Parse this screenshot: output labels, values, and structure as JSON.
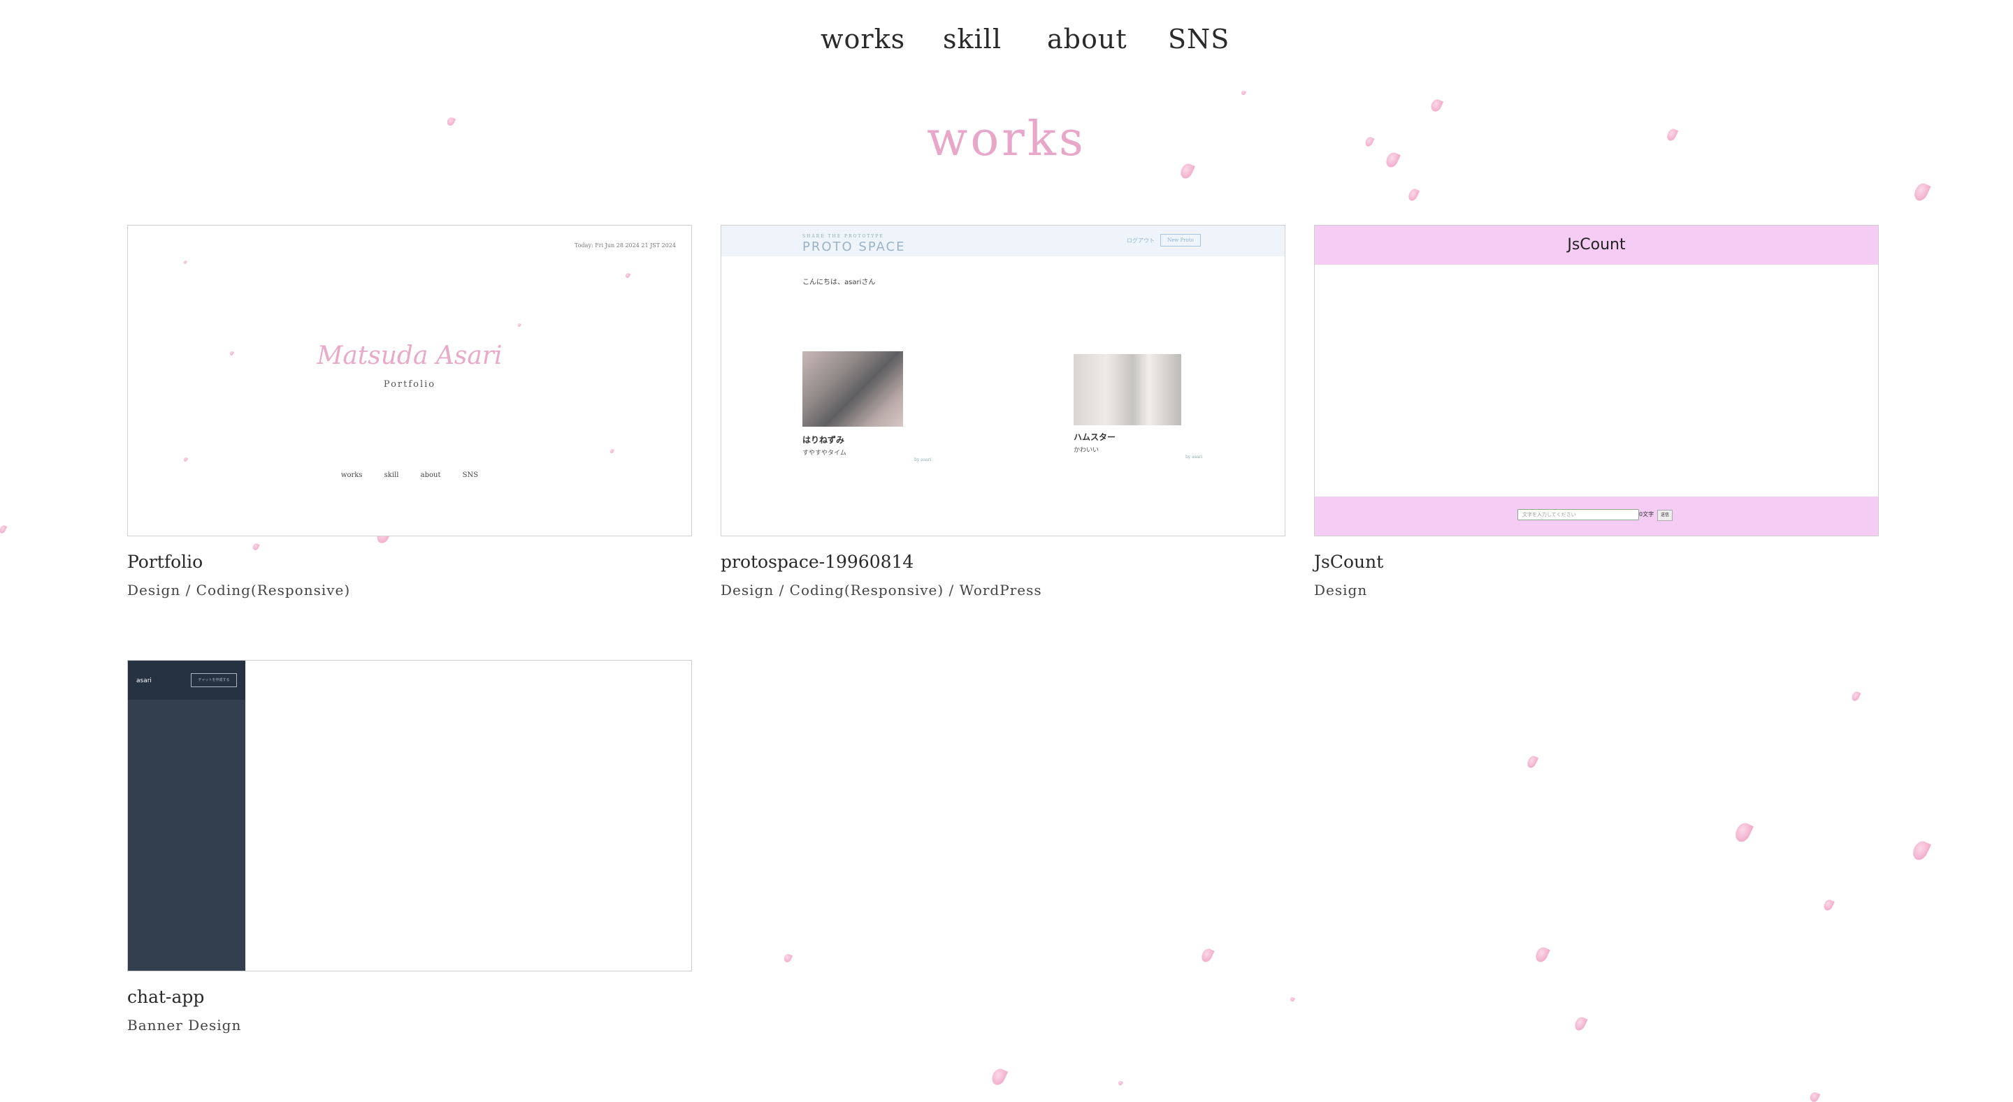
{
  "nav": {
    "items": [
      {
        "label": "works"
      },
      {
        "label": "skill"
      },
      {
        "label": "about"
      },
      {
        "label": "SNS"
      }
    ]
  },
  "section": {
    "title": "works"
  },
  "cards": [
    {
      "title": "Portfolio",
      "tags": "Design / Coding(Responsive)",
      "thumb": {
        "date": "Today: Fri Jun 28 2024 21 JST 2024",
        "name": "Matsuda Asari",
        "subtitle": "Portfolio",
        "nav": [
          "works",
          "skill",
          "about",
          "SNS"
        ]
      }
    },
    {
      "title": "protospace-19960814",
      "tags": "Design / Coding(Responsive) / WordPress",
      "thumb": {
        "tagline": "SHARE THE PROTOTYPE",
        "logo": "PROTO SPACE",
        "logout": "ログアウト",
        "new_button": "New Proto",
        "greeting": "こんにちは、asariさん",
        "items": [
          {
            "name": "はりねずみ",
            "catch": "すやすやタイム",
            "by": "by asari"
          },
          {
            "name": "ハムスター",
            "catch": "かわいい",
            "by": "by asari"
          }
        ]
      }
    },
    {
      "title": "JsCount",
      "tags": "Design",
      "thumb": {
        "header": "JsCount",
        "input_placeholder": "文字を入力してください",
        "count": "0文字",
        "button": "送信"
      }
    },
    {
      "title": "chat-app",
      "tags": "Banner Design",
      "thumb": {
        "user": "asari",
        "button": "チャットを作成する"
      }
    }
  ],
  "colors": {
    "accent": "#e8a6c9",
    "petal": "#f0a7c8",
    "jscount_bg": "#f4ccf4",
    "chat_sidebar": "#333e4f"
  }
}
